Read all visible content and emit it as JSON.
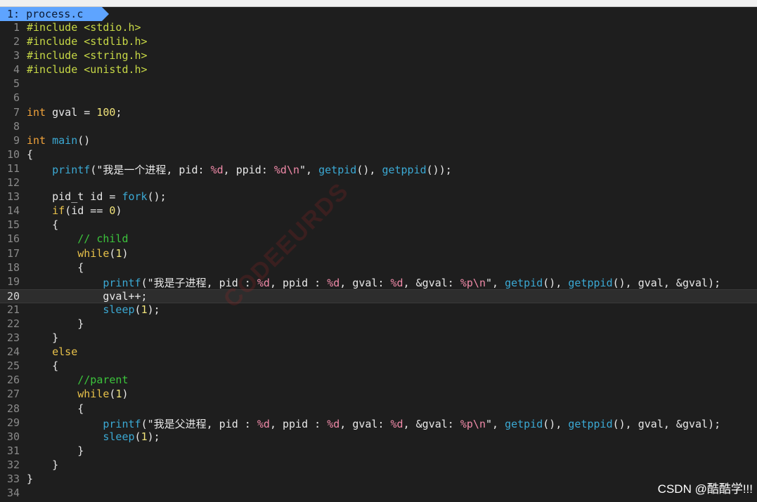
{
  "window": {
    "title": ""
  },
  "tab": {
    "label": "1: process.c"
  },
  "watermark": "CODEEURDS",
  "credit": "CSDN @酷酷学!!!",
  "editor": {
    "current_line": 20,
    "lines": [
      {
        "n": "1",
        "t": [
          [
            "pre",
            "#include <stdio.h>"
          ]
        ]
      },
      {
        "n": "2",
        "t": [
          [
            "pre",
            "#include <stdlib.h>"
          ]
        ]
      },
      {
        "n": "3",
        "t": [
          [
            "pre",
            "#include <string.h>"
          ]
        ]
      },
      {
        "n": "4",
        "t": [
          [
            "pre",
            "#include <unistd.h>"
          ]
        ]
      },
      {
        "n": "5",
        "t": []
      },
      {
        "n": "6",
        "t": []
      },
      {
        "n": "7",
        "t": [
          [
            "type",
            "int"
          ],
          [
            "punc",
            " gval = "
          ],
          [
            "num",
            "100"
          ],
          [
            "punc",
            ";"
          ]
        ]
      },
      {
        "n": "8",
        "t": []
      },
      {
        "n": "9",
        "t": [
          [
            "type",
            "int"
          ],
          [
            "punc",
            " "
          ],
          [
            "fn",
            "main"
          ],
          [
            "punc",
            "()"
          ]
        ]
      },
      {
        "n": "10",
        "t": [
          [
            "punc",
            "{"
          ]
        ]
      },
      {
        "n": "11",
        "t": [
          [
            "punc",
            "    "
          ],
          [
            "fn",
            "printf"
          ],
          [
            "punc",
            "(\""
          ],
          [
            "str",
            "我是一个进程, pid: "
          ],
          [
            "fmt",
            "%d"
          ],
          [
            "str",
            ", ppid: "
          ],
          [
            "fmt",
            "%d\\n"
          ],
          [
            "punc",
            "\", "
          ],
          [
            "fn",
            "getpid"
          ],
          [
            "punc",
            "(), "
          ],
          [
            "fn",
            "getppid"
          ],
          [
            "punc",
            "());"
          ]
        ]
      },
      {
        "n": "12",
        "t": []
      },
      {
        "n": "13",
        "t": [
          [
            "punc",
            "    pid_t id = "
          ],
          [
            "fn",
            "fork"
          ],
          [
            "punc",
            "();"
          ]
        ]
      },
      {
        "n": "14",
        "t": [
          [
            "punc",
            "    "
          ],
          [
            "ctl",
            "if"
          ],
          [
            "punc",
            "(id == "
          ],
          [
            "num",
            "0"
          ],
          [
            "punc",
            ")"
          ]
        ]
      },
      {
        "n": "15",
        "t": [
          [
            "punc",
            "    {"
          ]
        ]
      },
      {
        "n": "16",
        "t": [
          [
            "punc",
            "        "
          ],
          [
            "cmt",
            "// child"
          ]
        ]
      },
      {
        "n": "17",
        "t": [
          [
            "punc",
            "        "
          ],
          [
            "ctl",
            "while"
          ],
          [
            "punc",
            "("
          ],
          [
            "num",
            "1"
          ],
          [
            "punc",
            ")"
          ]
        ]
      },
      {
        "n": "18",
        "t": [
          [
            "punc",
            "        {"
          ]
        ]
      },
      {
        "n": "19",
        "t": [
          [
            "punc",
            "            "
          ],
          [
            "fn",
            "printf"
          ],
          [
            "punc",
            "(\""
          ],
          [
            "str",
            "我是子进程, pid : "
          ],
          [
            "fmt",
            "%d"
          ],
          [
            "str",
            ", ppid : "
          ],
          [
            "fmt",
            "%d"
          ],
          [
            "str",
            ", gval: "
          ],
          [
            "fmt",
            "%d"
          ],
          [
            "str",
            ", &gval: "
          ],
          [
            "fmt",
            "%p\\n"
          ],
          [
            "punc",
            "\", "
          ],
          [
            "fn",
            "getpid"
          ],
          [
            "punc",
            "(), "
          ],
          [
            "fn",
            "getppid"
          ],
          [
            "punc",
            "(), gval, &gval);"
          ]
        ]
      },
      {
        "n": "20",
        "t": [
          [
            "punc",
            "            gval++;"
          ]
        ]
      },
      {
        "n": "21",
        "t": [
          [
            "punc",
            "            "
          ],
          [
            "fn",
            "sleep"
          ],
          [
            "punc",
            "("
          ],
          [
            "num",
            "1"
          ],
          [
            "punc",
            ");"
          ]
        ]
      },
      {
        "n": "22",
        "t": [
          [
            "punc",
            "        }"
          ]
        ]
      },
      {
        "n": "23",
        "t": [
          [
            "punc",
            "    }"
          ]
        ]
      },
      {
        "n": "24",
        "t": [
          [
            "punc",
            "    "
          ],
          [
            "ctl",
            "else"
          ]
        ]
      },
      {
        "n": "25",
        "t": [
          [
            "punc",
            "    {"
          ]
        ]
      },
      {
        "n": "26",
        "t": [
          [
            "punc",
            "        "
          ],
          [
            "cmt",
            "//parent"
          ]
        ]
      },
      {
        "n": "27",
        "t": [
          [
            "punc",
            "        "
          ],
          [
            "ctl",
            "while"
          ],
          [
            "punc",
            "("
          ],
          [
            "num",
            "1"
          ],
          [
            "punc",
            ")"
          ]
        ]
      },
      {
        "n": "28",
        "t": [
          [
            "punc",
            "        {"
          ]
        ]
      },
      {
        "n": "29",
        "t": [
          [
            "punc",
            "            "
          ],
          [
            "fn",
            "printf"
          ],
          [
            "punc",
            "(\""
          ],
          [
            "str",
            "我是父进程, pid : "
          ],
          [
            "fmt",
            "%d"
          ],
          [
            "str",
            ", ppid : "
          ],
          [
            "fmt",
            "%d"
          ],
          [
            "str",
            ", gval: "
          ],
          [
            "fmt",
            "%d"
          ],
          [
            "str",
            ", &gval: "
          ],
          [
            "fmt",
            "%p\\n"
          ],
          [
            "punc",
            "\", "
          ],
          [
            "fn",
            "getpid"
          ],
          [
            "punc",
            "(), "
          ],
          [
            "fn",
            "getppid"
          ],
          [
            "punc",
            "(), gval, &gval);"
          ]
        ]
      },
      {
        "n": "30",
        "t": [
          [
            "punc",
            "            "
          ],
          [
            "fn",
            "sleep"
          ],
          [
            "punc",
            "("
          ],
          [
            "num",
            "1"
          ],
          [
            "punc",
            ");"
          ]
        ]
      },
      {
        "n": "31",
        "t": [
          [
            "punc",
            "        }"
          ]
        ]
      },
      {
        "n": "32",
        "t": [
          [
            "punc",
            "    }"
          ]
        ]
      },
      {
        "n": "33",
        "t": [
          [
            "punc",
            "}"
          ]
        ]
      },
      {
        "n": "34",
        "t": []
      }
    ]
  }
}
